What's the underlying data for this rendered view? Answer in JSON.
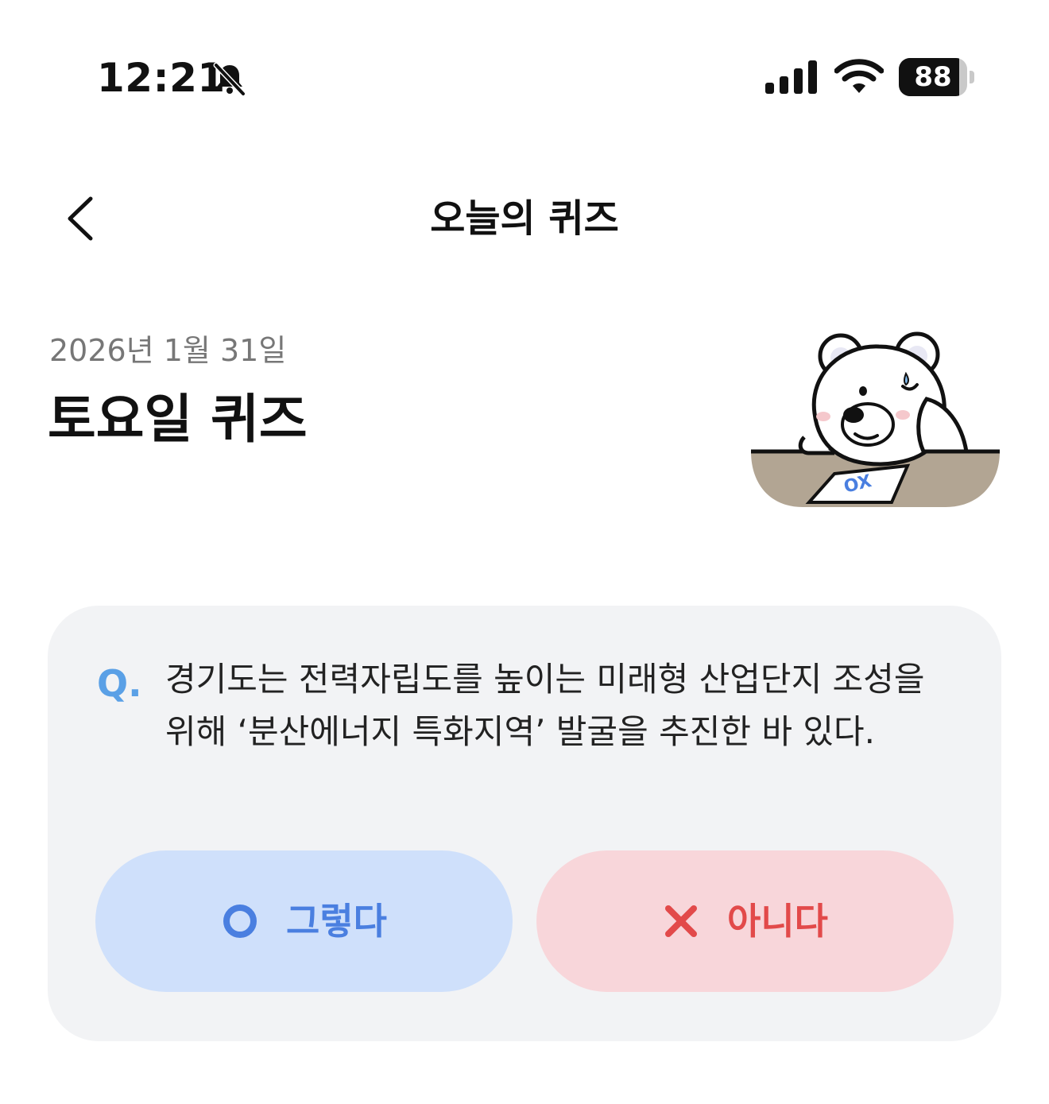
{
  "status_bar": {
    "time": "12:21",
    "mute_icon": "bell-slash-icon",
    "signal_icon": "cellular-signal-icon",
    "wifi_icon": "wifi-icon",
    "battery_level": "88",
    "battery_fraction": 0.88
  },
  "header": {
    "back_icon": "chevron-left-icon",
    "title": "오늘의 퀴즈"
  },
  "quiz": {
    "date": "2026년 1월 31일",
    "title": "토요일 퀴즈",
    "illustration": "polar-bear-ox-quiz-illustration",
    "illustration_text": "OX",
    "question_marker": "Q.",
    "question": "경기도는 전력자립도를 높이는 미래형 산업단지 조성을 위해 ‘분산에너지 특화지역’ 발굴을 추진한 바 있다.",
    "answers": {
      "yes": {
        "icon": "circle-o-icon",
        "label": "그렇다"
      },
      "no": {
        "icon": "x-mark-icon",
        "label": "아니다"
      }
    }
  },
  "colors": {
    "accent_blue": "#4a7fe0",
    "accent_red": "#e24a4a",
    "yes_bg": "#cfe0fb",
    "no_bg": "#f8d6da",
    "card_bg": "#f2f3f5",
    "q_marker": "#5aa0e6"
  }
}
